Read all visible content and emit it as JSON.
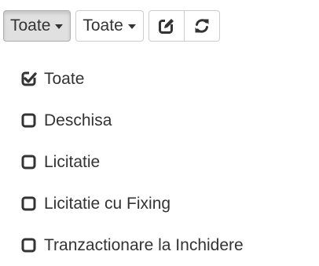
{
  "toolbar": {
    "filter1_label": "Toate",
    "filter2_label": "Toate",
    "edit_icon": "edit-square-icon",
    "refresh_icon": "refresh-icon"
  },
  "menu": {
    "items": [
      {
        "label": "Toate",
        "checked": true
      },
      {
        "label": "Deschisa",
        "checked": false
      },
      {
        "label": "Licitatie",
        "checked": false
      },
      {
        "label": "Licitatie cu Fixing",
        "checked": false
      },
      {
        "label": "Tranzactionare la Inchidere",
        "checked": false
      }
    ]
  }
}
